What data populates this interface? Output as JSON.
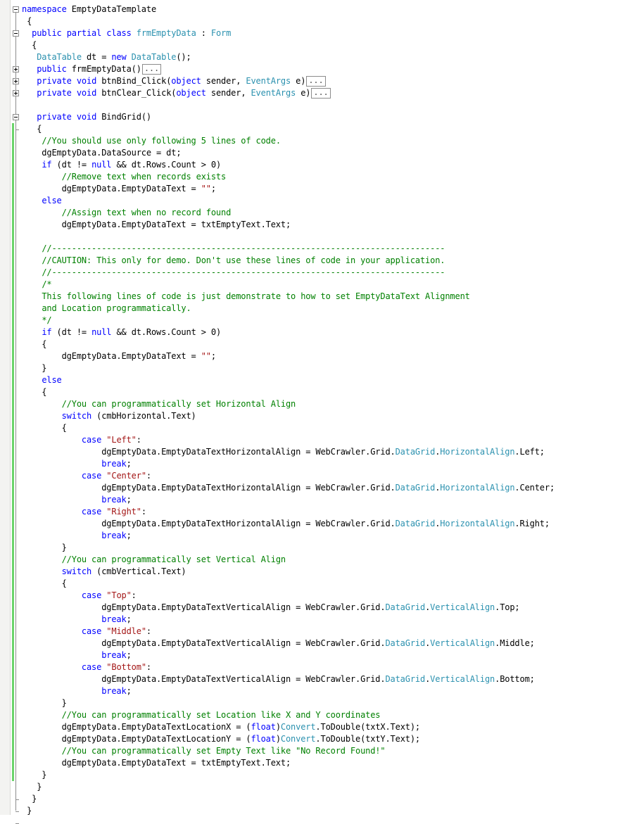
{
  "editor": {
    "language": "C#",
    "colors": {
      "keyword": "#0000ff",
      "type": "#2b91af",
      "string": "#a31515",
      "comment": "#008000",
      "changed_line_marker": "#6bd46b"
    },
    "lines": [
      [
        {
          "t": "namespace",
          "c": "kw"
        },
        {
          "t": " EmptyDataTemplate"
        }
      ],
      [
        {
          "t": " {"
        }
      ],
      [
        {
          "t": "  "
        },
        {
          "t": "public",
          "c": "kw"
        },
        {
          "t": " "
        },
        {
          "t": "partial",
          "c": "kw"
        },
        {
          "t": " "
        },
        {
          "t": "class",
          "c": "kw"
        },
        {
          "t": " "
        },
        {
          "t": "frmEmptyData",
          "c": "ty"
        },
        {
          "t": " : "
        },
        {
          "t": "Form",
          "c": "ty"
        }
      ],
      [
        {
          "t": "  {"
        }
      ],
      [
        {
          "t": "   "
        },
        {
          "t": "DataTable",
          "c": "ty"
        },
        {
          "t": " dt = "
        },
        {
          "t": "new",
          "c": "kw"
        },
        {
          "t": " "
        },
        {
          "t": "DataTable",
          "c": "ty"
        },
        {
          "t": "();"
        }
      ],
      [
        {
          "t": "   "
        },
        {
          "t": "public",
          "c": "kw"
        },
        {
          "t": " frmEmptyData()"
        },
        {
          "t": "...",
          "c": "fold"
        }
      ],
      [
        {
          "t": "   "
        },
        {
          "t": "private",
          "c": "kw"
        },
        {
          "t": " "
        },
        {
          "t": "void",
          "c": "kw"
        },
        {
          "t": " btnBind_Click("
        },
        {
          "t": "object",
          "c": "kw"
        },
        {
          "t": " sender, "
        },
        {
          "t": "EventArgs",
          "c": "ty"
        },
        {
          "t": " e)"
        },
        {
          "t": "...",
          "c": "fold"
        }
      ],
      [
        {
          "t": "   "
        },
        {
          "t": "private",
          "c": "kw"
        },
        {
          "t": " "
        },
        {
          "t": "void",
          "c": "kw"
        },
        {
          "t": " btnClear_Click("
        },
        {
          "t": "object",
          "c": "kw"
        },
        {
          "t": " sender, "
        },
        {
          "t": "EventArgs",
          "c": "ty"
        },
        {
          "t": " e)"
        },
        {
          "t": "...",
          "c": "fold"
        }
      ],
      [],
      [
        {
          "t": "   "
        },
        {
          "t": "private",
          "c": "kw"
        },
        {
          "t": " "
        },
        {
          "t": "void",
          "c": "kw"
        },
        {
          "t": " BindGrid()"
        }
      ],
      [
        {
          "t": "   {"
        }
      ],
      [
        {
          "t": "    "
        },
        {
          "t": "//You should use only following 5 lines of code.",
          "c": "cm"
        }
      ],
      [
        {
          "t": "    dgEmptyData.DataSource = dt;"
        }
      ],
      [
        {
          "t": "    "
        },
        {
          "t": "if",
          "c": "kw"
        },
        {
          "t": " (dt != "
        },
        {
          "t": "null",
          "c": "kw"
        },
        {
          "t": " && dt.Rows.Count > 0)"
        }
      ],
      [
        {
          "t": "        "
        },
        {
          "t": "//Remove text when records exists",
          "c": "cm"
        }
      ],
      [
        {
          "t": "        dgEmptyData.EmptyDataText = "
        },
        {
          "t": "\"\"",
          "c": "str"
        },
        {
          "t": ";"
        }
      ],
      [
        {
          "t": "    "
        },
        {
          "t": "else",
          "c": "kw"
        }
      ],
      [
        {
          "t": "        "
        },
        {
          "t": "//Assign text when no record found",
          "c": "cm"
        }
      ],
      [
        {
          "t": "        dgEmptyData.EmptyDataText = txtEmptyText.Text;"
        }
      ],
      [],
      [
        {
          "t": "    "
        },
        {
          "t": "//-------------------------------------------------------------------------------",
          "c": "cm"
        }
      ],
      [
        {
          "t": "    "
        },
        {
          "t": "//CAUTION: This only for demo. Don't use these lines of code in your application.",
          "c": "cm"
        }
      ],
      [
        {
          "t": "    "
        },
        {
          "t": "//-------------------------------------------------------------------------------",
          "c": "cm"
        }
      ],
      [
        {
          "t": "    "
        },
        {
          "t": "/*",
          "c": "cm"
        }
      ],
      [
        {
          "t": "    "
        },
        {
          "t": "This following lines of code is just demonstrate to how to set EmptyDataText Alignment",
          "c": "cm"
        }
      ],
      [
        {
          "t": "    "
        },
        {
          "t": "and Location programmatically.",
          "c": "cm"
        }
      ],
      [
        {
          "t": "    "
        },
        {
          "t": "*/",
          "c": "cm"
        }
      ],
      [
        {
          "t": "    "
        },
        {
          "t": "if",
          "c": "kw"
        },
        {
          "t": " (dt != "
        },
        {
          "t": "null",
          "c": "kw"
        },
        {
          "t": " && dt.Rows.Count > 0)"
        }
      ],
      [
        {
          "t": "    {"
        }
      ],
      [
        {
          "t": "        dgEmptyData.EmptyDataText = "
        },
        {
          "t": "\"\"",
          "c": "str"
        },
        {
          "t": ";"
        }
      ],
      [
        {
          "t": "    }"
        }
      ],
      [
        {
          "t": "    "
        },
        {
          "t": "else",
          "c": "kw"
        }
      ],
      [
        {
          "t": "    {"
        }
      ],
      [
        {
          "t": "        "
        },
        {
          "t": "//You can programmatically set Horizontal Align",
          "c": "cm"
        }
      ],
      [
        {
          "t": "        "
        },
        {
          "t": "switch",
          "c": "kw"
        },
        {
          "t": " (cmbHorizontal.Text)"
        }
      ],
      [
        {
          "t": "        {"
        }
      ],
      [
        {
          "t": "            "
        },
        {
          "t": "case",
          "c": "kw"
        },
        {
          "t": " "
        },
        {
          "t": "\"Left\"",
          "c": "str"
        },
        {
          "t": ":"
        }
      ],
      [
        {
          "t": "                dgEmptyData.EmptyDataTextHorizontalAlign = WebCrawler.Grid."
        },
        {
          "t": "DataGrid",
          "c": "ty"
        },
        {
          "t": "."
        },
        {
          "t": "HorizontalAlign",
          "c": "ty"
        },
        {
          "t": ".Left;"
        }
      ],
      [
        {
          "t": "                "
        },
        {
          "t": "break",
          "c": "kw"
        },
        {
          "t": ";"
        }
      ],
      [
        {
          "t": "            "
        },
        {
          "t": "case",
          "c": "kw"
        },
        {
          "t": " "
        },
        {
          "t": "\"Center\"",
          "c": "str"
        },
        {
          "t": ":"
        }
      ],
      [
        {
          "t": "                dgEmptyData.EmptyDataTextHorizontalAlign = WebCrawler.Grid."
        },
        {
          "t": "DataGrid",
          "c": "ty"
        },
        {
          "t": "."
        },
        {
          "t": "HorizontalAlign",
          "c": "ty"
        },
        {
          "t": ".Center;"
        }
      ],
      [
        {
          "t": "                "
        },
        {
          "t": "break",
          "c": "kw"
        },
        {
          "t": ";"
        }
      ],
      [
        {
          "t": "            "
        },
        {
          "t": "case",
          "c": "kw"
        },
        {
          "t": " "
        },
        {
          "t": "\"Right\"",
          "c": "str"
        },
        {
          "t": ":"
        }
      ],
      [
        {
          "t": "                dgEmptyData.EmptyDataTextHorizontalAlign = WebCrawler.Grid."
        },
        {
          "t": "DataGrid",
          "c": "ty"
        },
        {
          "t": "."
        },
        {
          "t": "HorizontalAlign",
          "c": "ty"
        },
        {
          "t": ".Right;"
        }
      ],
      [
        {
          "t": "                "
        },
        {
          "t": "break",
          "c": "kw"
        },
        {
          "t": ";"
        }
      ],
      [
        {
          "t": "        }"
        }
      ],
      [
        {
          "t": "        "
        },
        {
          "t": "//You can programmatically set Vertical Align",
          "c": "cm"
        }
      ],
      [
        {
          "t": "        "
        },
        {
          "t": "switch",
          "c": "kw"
        },
        {
          "t": " (cmbVertical.Text)"
        }
      ],
      [
        {
          "t": "        {"
        }
      ],
      [
        {
          "t": "            "
        },
        {
          "t": "case",
          "c": "kw"
        },
        {
          "t": " "
        },
        {
          "t": "\"Top\"",
          "c": "str"
        },
        {
          "t": ":"
        }
      ],
      [
        {
          "t": "                dgEmptyData.EmptyDataTextVerticalAlign = WebCrawler.Grid."
        },
        {
          "t": "DataGrid",
          "c": "ty"
        },
        {
          "t": "."
        },
        {
          "t": "VerticalAlign",
          "c": "ty"
        },
        {
          "t": ".Top;"
        }
      ],
      [
        {
          "t": "                "
        },
        {
          "t": "break",
          "c": "kw"
        },
        {
          "t": ";"
        }
      ],
      [
        {
          "t": "            "
        },
        {
          "t": "case",
          "c": "kw"
        },
        {
          "t": " "
        },
        {
          "t": "\"Middle\"",
          "c": "str"
        },
        {
          "t": ":"
        }
      ],
      [
        {
          "t": "                dgEmptyData.EmptyDataTextVerticalAlign = WebCrawler.Grid."
        },
        {
          "t": "DataGrid",
          "c": "ty"
        },
        {
          "t": "."
        },
        {
          "t": "VerticalAlign",
          "c": "ty"
        },
        {
          "t": ".Middle;"
        }
      ],
      [
        {
          "t": "                "
        },
        {
          "t": "break",
          "c": "kw"
        },
        {
          "t": ";"
        }
      ],
      [
        {
          "t": "            "
        },
        {
          "t": "case",
          "c": "kw"
        },
        {
          "t": " "
        },
        {
          "t": "\"Bottom\"",
          "c": "str"
        },
        {
          "t": ":"
        }
      ],
      [
        {
          "t": "                dgEmptyData.EmptyDataTextVerticalAlign = WebCrawler.Grid."
        },
        {
          "t": "DataGrid",
          "c": "ty"
        },
        {
          "t": "."
        },
        {
          "t": "VerticalAlign",
          "c": "ty"
        },
        {
          "t": ".Bottom;"
        }
      ],
      [
        {
          "t": "                "
        },
        {
          "t": "break",
          "c": "kw"
        },
        {
          "t": ";"
        }
      ],
      [
        {
          "t": "        }"
        }
      ],
      [
        {
          "t": "        "
        },
        {
          "t": "//You can programmatically set Location like X and Y coordinates",
          "c": "cm"
        }
      ],
      [
        {
          "t": "        dgEmptyData.EmptyDataTextLocationX = ("
        },
        {
          "t": "float",
          "c": "kw"
        },
        {
          "t": ")"
        },
        {
          "t": "Convert",
          "c": "ty"
        },
        {
          "t": ".ToDouble(txtX.Text);"
        }
      ],
      [
        {
          "t": "        dgEmptyData.EmptyDataTextLocationY = ("
        },
        {
          "t": "float",
          "c": "kw"
        },
        {
          "t": ")"
        },
        {
          "t": "Convert",
          "c": "ty"
        },
        {
          "t": ".ToDouble(txtY.Text);"
        }
      ],
      [
        {
          "t": "        "
        },
        {
          "t": "//You can programmatically set Empty Text like \"No Record Found!\"",
          "c": "cm"
        }
      ],
      [
        {
          "t": "        dgEmptyData.EmptyDataText = txtEmptyText.Text;"
        }
      ],
      [
        {
          "t": "    }"
        }
      ],
      [
        {
          "t": "   }"
        }
      ],
      [
        {
          "t": "  }"
        }
      ],
      [
        {
          "t": " }"
        }
      ]
    ],
    "outline_markers": [
      {
        "line": 0,
        "state": "expanded"
      },
      {
        "line": 2,
        "state": "expanded"
      },
      {
        "line": 5,
        "state": "collapsed"
      },
      {
        "line": 6,
        "state": "collapsed"
      },
      {
        "line": 7,
        "state": "collapsed"
      },
      {
        "line": 9,
        "state": "expanded"
      }
    ]
  }
}
